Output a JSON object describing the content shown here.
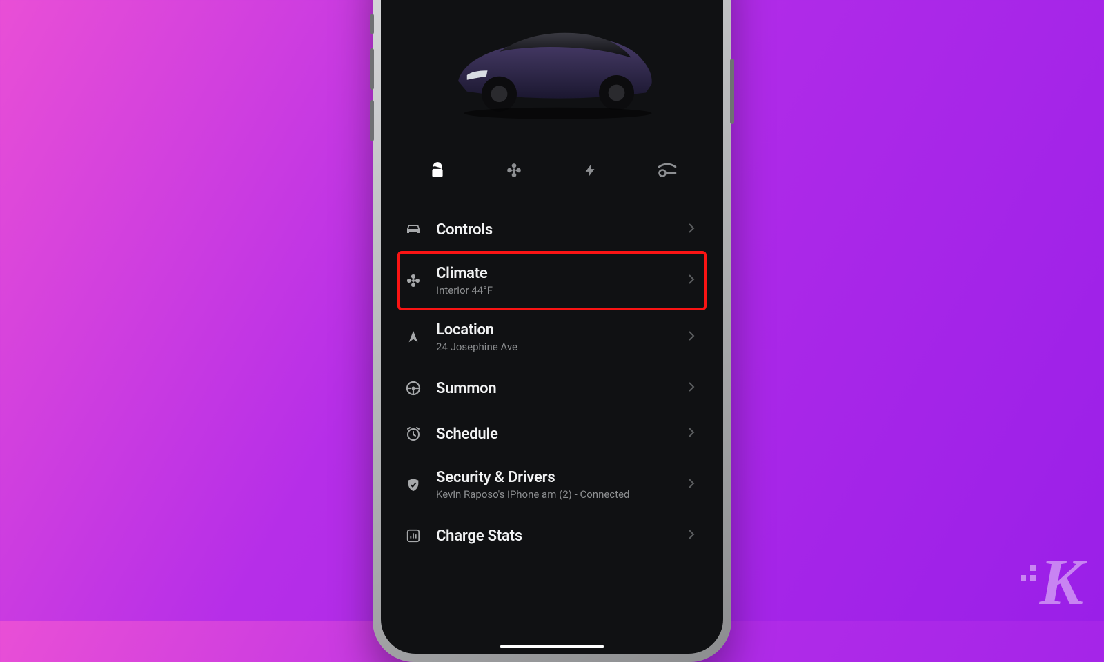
{
  "quick_actions": [
    {
      "name": "lock-icon",
      "active": true
    },
    {
      "name": "fan-icon",
      "active": false
    },
    {
      "name": "bolt-icon",
      "active": false
    },
    {
      "name": "charge-port-icon",
      "active": false
    }
  ],
  "menu": {
    "controls": {
      "title": "Controls",
      "subtitle": "",
      "icon": "car-front-icon"
    },
    "climate": {
      "title": "Climate",
      "subtitle": "Interior 44°F",
      "icon": "fan-icon",
      "highlighted": true
    },
    "location": {
      "title": "Location",
      "subtitle": "24 Josephine Ave",
      "icon": "nav-arrow-icon"
    },
    "summon": {
      "title": "Summon",
      "subtitle": "",
      "icon": "steering-wheel-icon"
    },
    "schedule": {
      "title": "Schedule",
      "subtitle": "",
      "icon": "clock-icon"
    },
    "security": {
      "title": "Security & Drivers",
      "subtitle": "Kevin Raposo's iPhone am (2) - Connected",
      "icon": "shield-icon"
    },
    "charge_stats": {
      "title": "Charge Stats",
      "subtitle": "",
      "icon": "bar-chart-icon"
    }
  },
  "vehicle_image": "purple-sedan",
  "watermark": "K"
}
